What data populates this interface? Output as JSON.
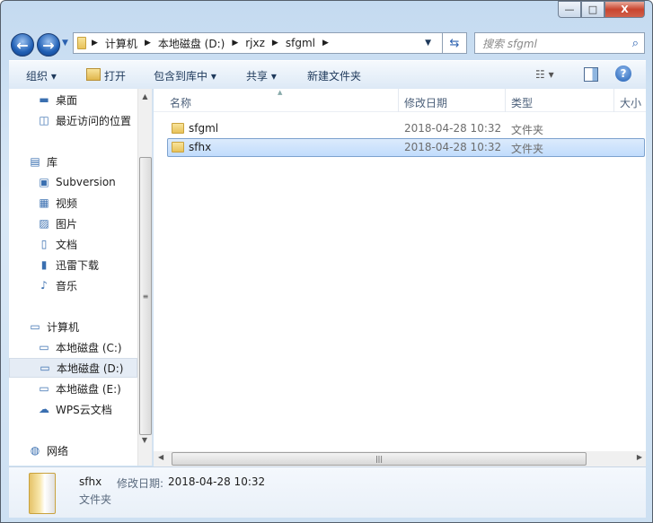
{
  "window": {
    "minimize": "—",
    "maximize": "□",
    "close": "X"
  },
  "address": {
    "segments": [
      "计算机",
      "本地磁盘 (D:)",
      "rjxz",
      "sfgml"
    ],
    "separator": "▸"
  },
  "search": {
    "placeholder": "搜索 sfgml"
  },
  "toolbar": {
    "organize": "组织 ▾",
    "open": "打开",
    "include": "包含到库中 ▾",
    "share": "共享 ▾",
    "new_folder": "新建文件夹"
  },
  "sidebar": {
    "items": [
      {
        "label": "桌面",
        "icon": "desktop-icon"
      },
      {
        "label": "最近访问的位置",
        "icon": "recent-icon"
      },
      {
        "label": "库",
        "icon": "library-icon"
      },
      {
        "label": "Subversion",
        "icon": "subversion-icon"
      },
      {
        "label": "视频",
        "icon": "video-icon"
      },
      {
        "label": "图片",
        "icon": "picture-icon"
      },
      {
        "label": "文档",
        "icon": "document-icon"
      },
      {
        "label": "迅雷下载",
        "icon": "download-icon"
      },
      {
        "label": "音乐",
        "icon": "music-icon"
      },
      {
        "label": "计算机",
        "icon": "computer-icon"
      },
      {
        "label": "本地磁盘 (C:)",
        "icon": "drive-icon"
      },
      {
        "label": "本地磁盘 (D:)",
        "icon": "drive-icon",
        "selected": true
      },
      {
        "label": "本地磁盘 (E:)",
        "icon": "drive-icon"
      },
      {
        "label": "WPS云文档",
        "icon": "cloud-icon"
      },
      {
        "label": "网络",
        "icon": "network-icon"
      }
    ]
  },
  "columns": {
    "name": "名称",
    "modified": "修改日期",
    "type": "类型",
    "size": "大小"
  },
  "files": [
    {
      "name": "sfgml",
      "modified": "2018-04-28 10:32",
      "type": "文件夹"
    },
    {
      "name": "sfhx",
      "modified": "2018-04-28 10:32",
      "type": "文件夹",
      "selected": true
    }
  ],
  "details": {
    "name": "sfhx",
    "modified_label": "修改日期:",
    "modified": "2018-04-28 10:32",
    "type": "文件夹"
  }
}
